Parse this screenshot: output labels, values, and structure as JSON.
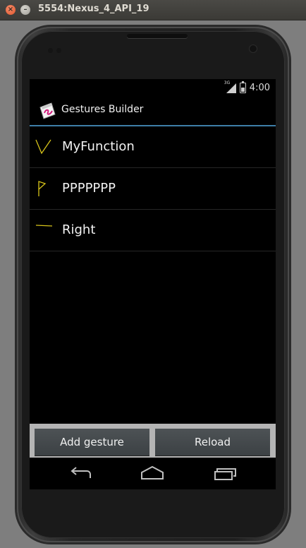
{
  "window": {
    "title": "5554:Nexus_4_API_19"
  },
  "status_bar": {
    "network": "3G",
    "time": "4:00"
  },
  "action_bar": {
    "title": "Gestures Builder",
    "icon": "gestures-builder-app-icon"
  },
  "gestures": [
    {
      "name": "MyFunction",
      "icon": "v-stroke-gesture-icon"
    },
    {
      "name": "PPPPPPP",
      "icon": "flag-stroke-gesture-icon"
    },
    {
      "name": "Right",
      "icon": "horizontal-line-gesture-icon"
    }
  ],
  "buttons": {
    "add": "Add gesture",
    "reload": "Reload"
  },
  "nav": [
    "back-icon",
    "home-icon",
    "recent-apps-icon"
  ],
  "colors": {
    "accent": "#3e7ea8",
    "gesture_stroke": "#d6c31a"
  }
}
